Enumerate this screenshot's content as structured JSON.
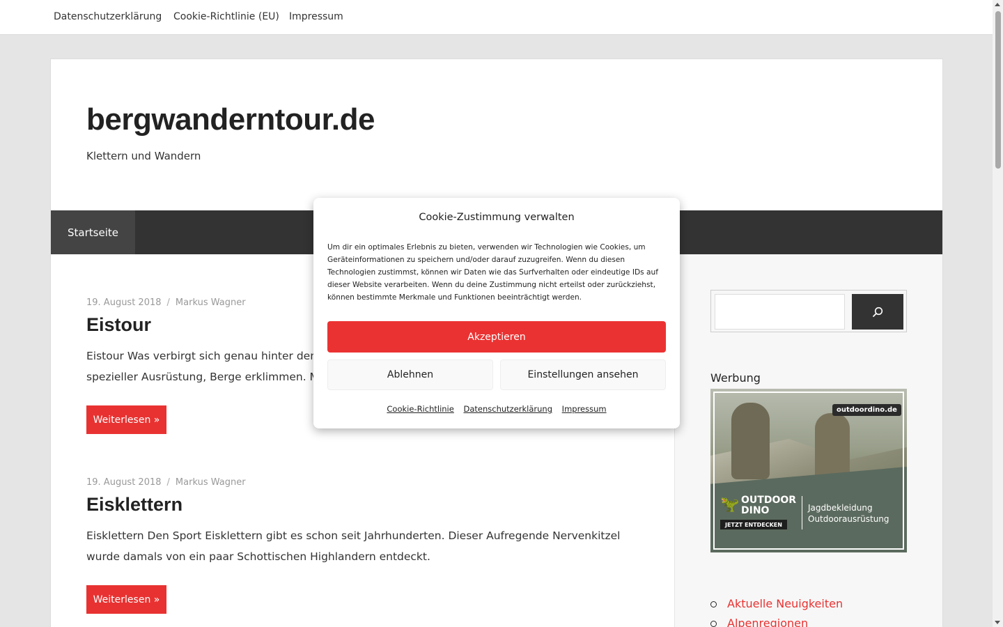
{
  "topnav": {
    "items": [
      "Datenschutzerklärung",
      "Cookie-Richtlinie (EU)",
      "Impressum"
    ]
  },
  "site": {
    "title": "bergwanderntour.de",
    "description": "Klettern und Wandern"
  },
  "mainnav": {
    "items": [
      "Startseite"
    ]
  },
  "posts": [
    {
      "date": "19. August 2018",
      "separator": "/",
      "author": "Markus Wagner",
      "title": "Eistour",
      "excerpt": "Eistour Was verbirgt sich genau hinter dem Be",
      "excerpt_line2": "spezieller Ausrüstung, Berge erklimmen. Man",
      "more_label": "Weiterlesen »"
    },
    {
      "date": "19. August 2018",
      "separator": "/",
      "author": "Markus Wagner",
      "title": "Eisklettern",
      "excerpt": "Eisklettern Den Sport Eisklettern gibt es schon seit Jahrhunderten. Dieser Aufregende Nervenkitzel wurde damals von ein paar Schottischen Highlandern entdeckt.",
      "more_label": "Weiterlesen »"
    }
  ],
  "sidebar": {
    "search": {
      "placeholder": "",
      "button_icon": "search-icon"
    },
    "ad": {
      "heading": "Werbung",
      "tag": "outdoordino.de",
      "brand_line1": "OUTDOOR",
      "brand_line2": "DINO",
      "cta": "JETZT ENTDECKEN",
      "slogan_line1": "Jagdbekleidung",
      "slogan_line2": "Outdoorausrüstung"
    },
    "categories": [
      "Aktuelle Neuigkeiten",
      "Alpenregionen"
    ]
  },
  "cookie_modal": {
    "title": "Cookie-Zustimmung verwalten",
    "text": "Um dir ein optimales Erlebnis zu bieten, verwenden wir Technologien wie Cookies, um Geräteinformationen zu speichern und/oder darauf zuzugreifen. Wenn du diesen Technologien zustimmst, können wir Daten wie das Surfverhalten oder eindeutige IDs auf dieser Website verarbeiten. Wenn du deine Zustimmung nicht erteilst oder zurückziehst, können bestimmte Merkmale und Funktionen beeinträchtigt werden.",
    "accept_label": "Akzeptieren",
    "deny_label": "Ablehnen",
    "settings_label": "Einstellungen ansehen",
    "links": [
      "Cookie-Richtlinie",
      "Datenschutzerklärung",
      "Impressum"
    ]
  },
  "colors": {
    "accent": "#e83231",
    "nav_bg": "#333333",
    "page_bg": "#e5e5e5"
  }
}
